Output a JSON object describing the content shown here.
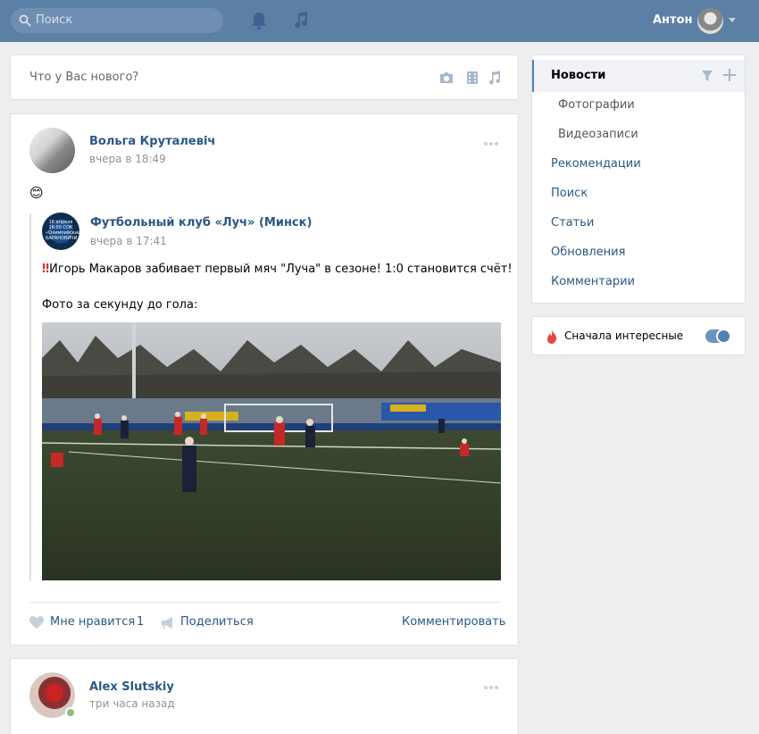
{
  "header": {
    "search_placeholder": "Поиск",
    "user_name": "Антон",
    "icons": [
      "search-icon",
      "bell-icon",
      "music-icon",
      "chevron-down-icon"
    ]
  },
  "composer": {
    "placeholder": "Что у Вас нового?",
    "icons": [
      "camera-icon",
      "video-icon",
      "music-icon"
    ]
  },
  "posts": [
    {
      "author": "Вольга Круталевіч",
      "time": "вчера в 18:49",
      "text": "😊",
      "repost": {
        "author": "Футбольный клуб «Луч» (Минск)",
        "time": "вчера в 17:41",
        "line1": "‼️Игорь Макаров забивает первый мяч \"Луча\" в сезоне! 1:0 становится счёт!",
        "line1_mark": "‼",
        "line1_text": "Игорь Макаров забивает первый мяч \"Луча\" в сезоне! 1:0 становится счёт!",
        "line2": "Фото за секунду до гола:",
        "avatar_text": "16 апреля 16:00 СОК «Олимпийский» БАРАНОВИЧИ"
      },
      "actions": {
        "like_label": "Мне нравится",
        "like_count": "1",
        "share_label": "Поделиться",
        "comment_label": "Комментировать"
      }
    },
    {
      "author": "Alex Slutskiy",
      "time": "три часа назад",
      "online": true
    }
  ],
  "sidebar": {
    "items": [
      {
        "label": "Новости",
        "active": true
      },
      {
        "label": "Фотографии",
        "sub": true
      },
      {
        "label": "Видеозаписи",
        "sub": true
      },
      {
        "label": "Рекомендации"
      },
      {
        "label": "Поиск"
      },
      {
        "label": "Статьи"
      },
      {
        "label": "Обновления"
      },
      {
        "label": "Комментарии"
      }
    ],
    "smart_feed_label": "Сначала интересные",
    "smart_feed_on": true
  },
  "colors": {
    "header_bg": "#5c7fa6",
    "link": "#2a5885",
    "page_bg": "#edeef0",
    "accent": "#5181b8"
  }
}
